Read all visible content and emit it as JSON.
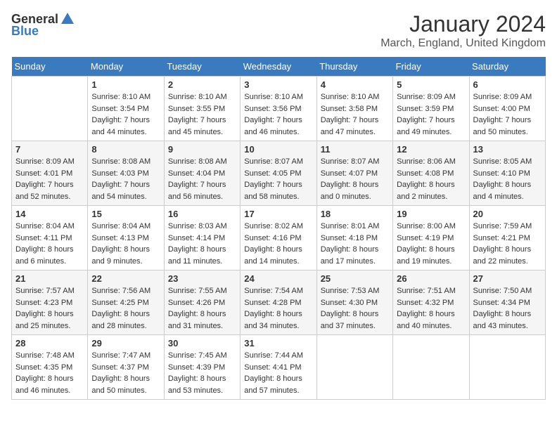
{
  "logo": {
    "general": "General",
    "blue": "Blue"
  },
  "title": "January 2024",
  "subtitle": "March, England, United Kingdom",
  "days_of_week": [
    "Sunday",
    "Monday",
    "Tuesday",
    "Wednesday",
    "Thursday",
    "Friday",
    "Saturday"
  ],
  "weeks": [
    [
      {
        "day": "",
        "sunrise": "",
        "sunset": "",
        "daylight": ""
      },
      {
        "day": "1",
        "sunrise": "Sunrise: 8:10 AM",
        "sunset": "Sunset: 3:54 PM",
        "daylight": "Daylight: 7 hours and 44 minutes."
      },
      {
        "day": "2",
        "sunrise": "Sunrise: 8:10 AM",
        "sunset": "Sunset: 3:55 PM",
        "daylight": "Daylight: 7 hours and 45 minutes."
      },
      {
        "day": "3",
        "sunrise": "Sunrise: 8:10 AM",
        "sunset": "Sunset: 3:56 PM",
        "daylight": "Daylight: 7 hours and 46 minutes."
      },
      {
        "day": "4",
        "sunrise": "Sunrise: 8:10 AM",
        "sunset": "Sunset: 3:58 PM",
        "daylight": "Daylight: 7 hours and 47 minutes."
      },
      {
        "day": "5",
        "sunrise": "Sunrise: 8:09 AM",
        "sunset": "Sunset: 3:59 PM",
        "daylight": "Daylight: 7 hours and 49 minutes."
      },
      {
        "day": "6",
        "sunrise": "Sunrise: 8:09 AM",
        "sunset": "Sunset: 4:00 PM",
        "daylight": "Daylight: 7 hours and 50 minutes."
      }
    ],
    [
      {
        "day": "7",
        "sunrise": "Sunrise: 8:09 AM",
        "sunset": "Sunset: 4:01 PM",
        "daylight": "Daylight: 7 hours and 52 minutes."
      },
      {
        "day": "8",
        "sunrise": "Sunrise: 8:08 AM",
        "sunset": "Sunset: 4:03 PM",
        "daylight": "Daylight: 7 hours and 54 minutes."
      },
      {
        "day": "9",
        "sunrise": "Sunrise: 8:08 AM",
        "sunset": "Sunset: 4:04 PM",
        "daylight": "Daylight: 7 hours and 56 minutes."
      },
      {
        "day": "10",
        "sunrise": "Sunrise: 8:07 AM",
        "sunset": "Sunset: 4:05 PM",
        "daylight": "Daylight: 7 hours and 58 minutes."
      },
      {
        "day": "11",
        "sunrise": "Sunrise: 8:07 AM",
        "sunset": "Sunset: 4:07 PM",
        "daylight": "Daylight: 8 hours and 0 minutes."
      },
      {
        "day": "12",
        "sunrise": "Sunrise: 8:06 AM",
        "sunset": "Sunset: 4:08 PM",
        "daylight": "Daylight: 8 hours and 2 minutes."
      },
      {
        "day": "13",
        "sunrise": "Sunrise: 8:05 AM",
        "sunset": "Sunset: 4:10 PM",
        "daylight": "Daylight: 8 hours and 4 minutes."
      }
    ],
    [
      {
        "day": "14",
        "sunrise": "Sunrise: 8:04 AM",
        "sunset": "Sunset: 4:11 PM",
        "daylight": "Daylight: 8 hours and 6 minutes."
      },
      {
        "day": "15",
        "sunrise": "Sunrise: 8:04 AM",
        "sunset": "Sunset: 4:13 PM",
        "daylight": "Daylight: 8 hours and 9 minutes."
      },
      {
        "day": "16",
        "sunrise": "Sunrise: 8:03 AM",
        "sunset": "Sunset: 4:14 PM",
        "daylight": "Daylight: 8 hours and 11 minutes."
      },
      {
        "day": "17",
        "sunrise": "Sunrise: 8:02 AM",
        "sunset": "Sunset: 4:16 PM",
        "daylight": "Daylight: 8 hours and 14 minutes."
      },
      {
        "day": "18",
        "sunrise": "Sunrise: 8:01 AM",
        "sunset": "Sunset: 4:18 PM",
        "daylight": "Daylight: 8 hours and 17 minutes."
      },
      {
        "day": "19",
        "sunrise": "Sunrise: 8:00 AM",
        "sunset": "Sunset: 4:19 PM",
        "daylight": "Daylight: 8 hours and 19 minutes."
      },
      {
        "day": "20",
        "sunrise": "Sunrise: 7:59 AM",
        "sunset": "Sunset: 4:21 PM",
        "daylight": "Daylight: 8 hours and 22 minutes."
      }
    ],
    [
      {
        "day": "21",
        "sunrise": "Sunrise: 7:57 AM",
        "sunset": "Sunset: 4:23 PM",
        "daylight": "Daylight: 8 hours and 25 minutes."
      },
      {
        "day": "22",
        "sunrise": "Sunrise: 7:56 AM",
        "sunset": "Sunset: 4:25 PM",
        "daylight": "Daylight: 8 hours and 28 minutes."
      },
      {
        "day": "23",
        "sunrise": "Sunrise: 7:55 AM",
        "sunset": "Sunset: 4:26 PM",
        "daylight": "Daylight: 8 hours and 31 minutes."
      },
      {
        "day": "24",
        "sunrise": "Sunrise: 7:54 AM",
        "sunset": "Sunset: 4:28 PM",
        "daylight": "Daylight: 8 hours and 34 minutes."
      },
      {
        "day": "25",
        "sunrise": "Sunrise: 7:53 AM",
        "sunset": "Sunset: 4:30 PM",
        "daylight": "Daylight: 8 hours and 37 minutes."
      },
      {
        "day": "26",
        "sunrise": "Sunrise: 7:51 AM",
        "sunset": "Sunset: 4:32 PM",
        "daylight": "Daylight: 8 hours and 40 minutes."
      },
      {
        "day": "27",
        "sunrise": "Sunrise: 7:50 AM",
        "sunset": "Sunset: 4:34 PM",
        "daylight": "Daylight: 8 hours and 43 minutes."
      }
    ],
    [
      {
        "day": "28",
        "sunrise": "Sunrise: 7:48 AM",
        "sunset": "Sunset: 4:35 PM",
        "daylight": "Daylight: 8 hours and 46 minutes."
      },
      {
        "day": "29",
        "sunrise": "Sunrise: 7:47 AM",
        "sunset": "Sunset: 4:37 PM",
        "daylight": "Daylight: 8 hours and 50 minutes."
      },
      {
        "day": "30",
        "sunrise": "Sunrise: 7:45 AM",
        "sunset": "Sunset: 4:39 PM",
        "daylight": "Daylight: 8 hours and 53 minutes."
      },
      {
        "day": "31",
        "sunrise": "Sunrise: 7:44 AM",
        "sunset": "Sunset: 4:41 PM",
        "daylight": "Daylight: 8 hours and 57 minutes."
      },
      {
        "day": "",
        "sunrise": "",
        "sunset": "",
        "daylight": ""
      },
      {
        "day": "",
        "sunrise": "",
        "sunset": "",
        "daylight": ""
      },
      {
        "day": "",
        "sunrise": "",
        "sunset": "",
        "daylight": ""
      }
    ]
  ]
}
